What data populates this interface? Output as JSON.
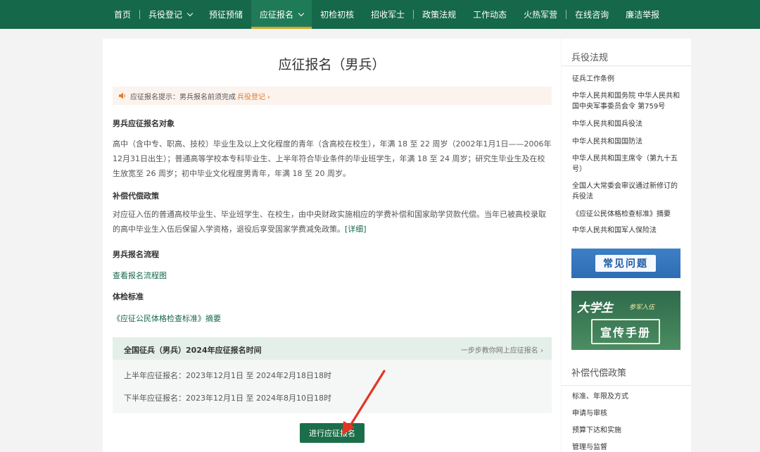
{
  "nav": {
    "items": [
      {
        "label": "首页"
      },
      {
        "label": "兵役登记"
      },
      {
        "label": "预征预储"
      },
      {
        "label": "应征报名"
      },
      {
        "label": "初检初核"
      },
      {
        "label": "招收军士"
      },
      {
        "label": "政策法规"
      },
      {
        "label": "工作动态"
      },
      {
        "label": "火热军营"
      },
      {
        "label": "在线咨询"
      },
      {
        "label": "廉洁举报"
      }
    ]
  },
  "main": {
    "title": "应征报名（男兵）",
    "notice": {
      "prefix": "应征报名提示：男兵报名前须完成",
      "link": "兵役登记",
      "arrow": "›"
    },
    "sections": {
      "target": {
        "heading": "男兵应征报名对象",
        "text": "高中（含中专、职高、技校）毕业生及以上文化程度的青年（含高校在校生），年满 18 至 22 周岁（2002年1月1日——2006年12月31日出生）；普通高等学校本专科毕业生、上半年符合毕业条件的毕业班学生，年满 18 至 24 周岁；研究生毕业生及在校生放宽至 26 周岁；初中毕业文化程度男青年，年满 18 至 20 周岁。"
      },
      "policy": {
        "heading": "补偿代偿政策",
        "text": "对应征入伍的普通高校毕业生、毕业班学生、在校生，由中央财政实施相应的学费补偿和国家助学贷款代偿。当年已被高校录取的高中毕业生入伍后保留入学资格，退役后享受国家学费减免政策。",
        "detail": "[详细]"
      },
      "process": {
        "heading": "男兵报名流程",
        "link": "查看报名流程图"
      },
      "standard": {
        "heading": "体检标准",
        "link": "《应征公民体格检查标准》摘要"
      }
    },
    "schedule": {
      "title": "全国征兵（男兵）2024年应征报名时间",
      "guide": "一步步教你网上应征报名 ›",
      "first_half": "上半年应征报名：2023年12月1日 至 2024年2月18日18时",
      "second_half": "下半年应征报名：2023年12月1日 至 2024年8月10日18时"
    },
    "submit_label": "进行应征报名"
  },
  "sidebar": {
    "law_heading": "兵役法规",
    "law_links": [
      "征兵工作条例",
      "中华人民共和国务院 中华人民共和国中央军事委员会令 第759号",
      "中华人民共和国兵役法",
      "中华人民共和国国防法",
      "中华人民共和国主席令（第九十五号）",
      "全国人大常委会审议通过新修订的兵役法",
      "《应征公民体格检查标准》摘要",
      "中华人民共和国军人保险法"
    ],
    "faq_banner": "常见问题",
    "handbook_banner": {
      "big": "大学生",
      "small": "参军入伍",
      "book": "宣传手册"
    },
    "comp_heading": "补偿代偿政策",
    "comp_links": [
      "标准、年限及方式",
      "申请与审核",
      "预算下达和实施",
      "管理与监督"
    ]
  },
  "colors": {
    "nav_bg": "#16684a",
    "active_underline": "#d4a72c",
    "link_green": "#16684a",
    "notice_orange": "#e07b2b",
    "annotation_red": "#e53424"
  }
}
